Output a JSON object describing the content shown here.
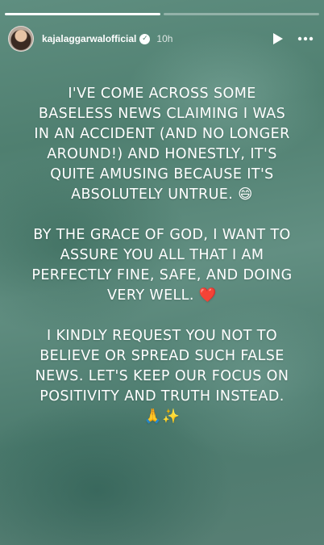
{
  "progress": {
    "segments": 2,
    "active_index": 1,
    "active_fraction": 0.0,
    "completed_fraction": 1.0
  },
  "header": {
    "username": "kajalaggarwalofficial",
    "verified": true,
    "time": "10h",
    "play_icon": "play-icon",
    "more_icon": "more-icon"
  },
  "story": {
    "paragraphs": [
      "I'VE COME ACROSS SOME BASELESS NEWS CLAIMING I WAS IN AN ACCIDENT (AND NO LONGER AROUND!) AND HONESTLY, IT'S QUITE AMUSING BECAUSE IT'S ABSOLUTELY UNTRUE. 😄",
      "BY THE GRACE OF GOD, I WANT TO ASSURE YOU ALL THAT I AM PERFECTLY FINE, SAFE, AND DOING VERY WELL. ❤️",
      "I KINDLY REQUEST YOU NOT TO BELIEVE OR SPREAD SUCH FALSE NEWS. LET'S KEEP OUR FOCUS ON POSITIVITY AND TRUTH INSTEAD. 🙏✨"
    ]
  }
}
